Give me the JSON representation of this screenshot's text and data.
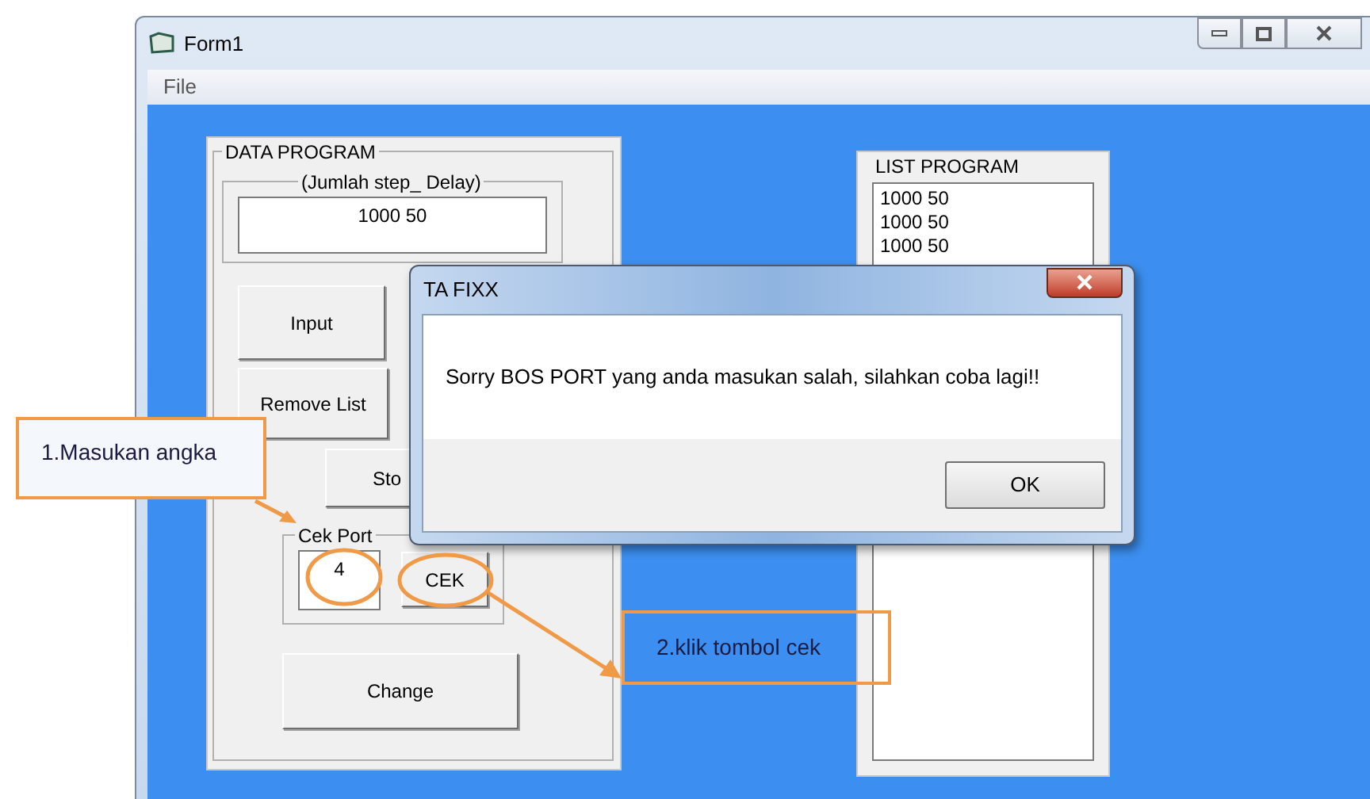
{
  "window": {
    "title": "Form1"
  },
  "menu": [
    "File"
  ],
  "data_program": {
    "title": "DATA PROGRAM",
    "delay_frame_title": "(Jumlah step_ Delay)",
    "delay_value": "1000 50",
    "buttons": [
      "Input",
      "Remove List",
      "Sto"
    ],
    "cek_port": {
      "title": "Cek Port",
      "value": "4",
      "button": "CEK"
    },
    "change_button": "Change"
  },
  "list_program": {
    "title": "LIST PROGRAM",
    "items": [
      "1000 50",
      "1000 50",
      "1000 50"
    ]
  },
  "dialog": {
    "title": "TA FIXX",
    "message": "Sorry BOS PORT yang anda masukan salah, silahkan coba lagi!!",
    "button": "OK"
  },
  "annotations": [
    {
      "text": "1.Masukan angka"
    },
    {
      "text": "2.klik tombol cek"
    }
  ]
}
